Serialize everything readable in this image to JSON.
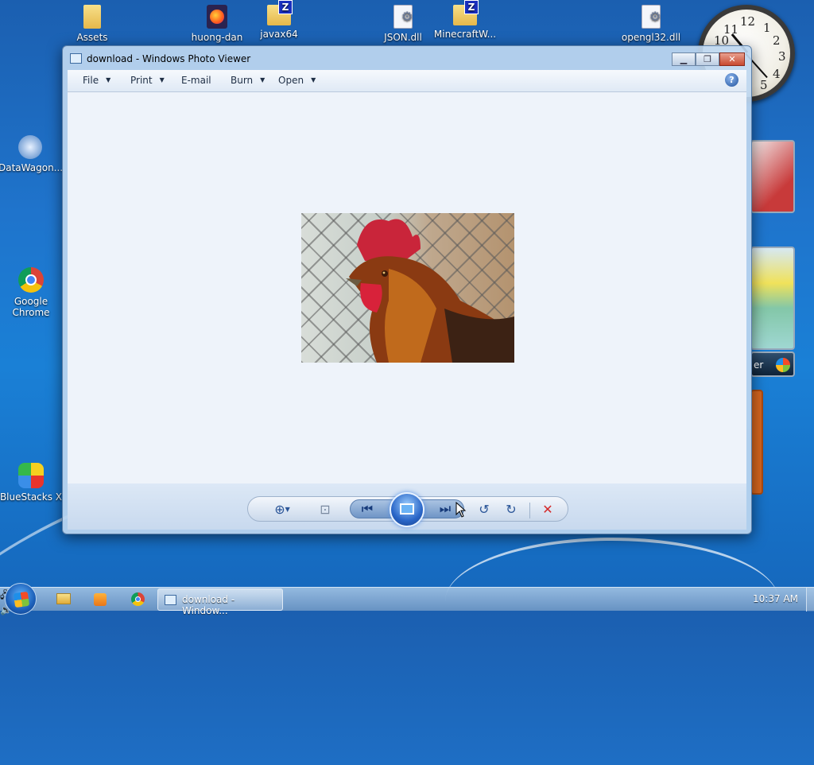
{
  "desktop": {
    "icons": [
      {
        "label": "Assets"
      },
      {
        "label": "huong-dan"
      },
      {
        "label": "javax64"
      },
      {
        "label": "JSON.dll"
      },
      {
        "label": "MinecraftW..."
      },
      {
        "label": "opengl32.dll"
      },
      {
        "label": "DataWagon..."
      },
      {
        "label": "Google Chrome"
      },
      {
        "label": "BlueStacks X"
      }
    ],
    "clock": {
      "numbers": [
        "12",
        "1",
        "2",
        "3",
        "4",
        "5",
        "10",
        "11"
      ]
    },
    "gadget_label": "er"
  },
  "window": {
    "title": "download - Windows Photo Viewer",
    "buttons": {
      "minimize": "▁",
      "restore": "❐",
      "close": "✕"
    },
    "menu": {
      "file": "File",
      "print": "Print",
      "email": "E-mail",
      "burn": "Burn",
      "open": "Open",
      "help": "?"
    },
    "controls": {
      "zoom": "⊕",
      "actual_size": "⊡",
      "previous": "⏮",
      "next": "⏭",
      "rotate_ccw": "↺",
      "rotate_cw": "↻",
      "delete": "✕"
    }
  },
  "taskbar": {
    "active_window_label": "download - Window...",
    "time": "10:37 AM"
  },
  "colors": {
    "desktop_blue": "#1f74cc",
    "delete_red": "#d42a2a",
    "close_button": "#c84a30"
  }
}
